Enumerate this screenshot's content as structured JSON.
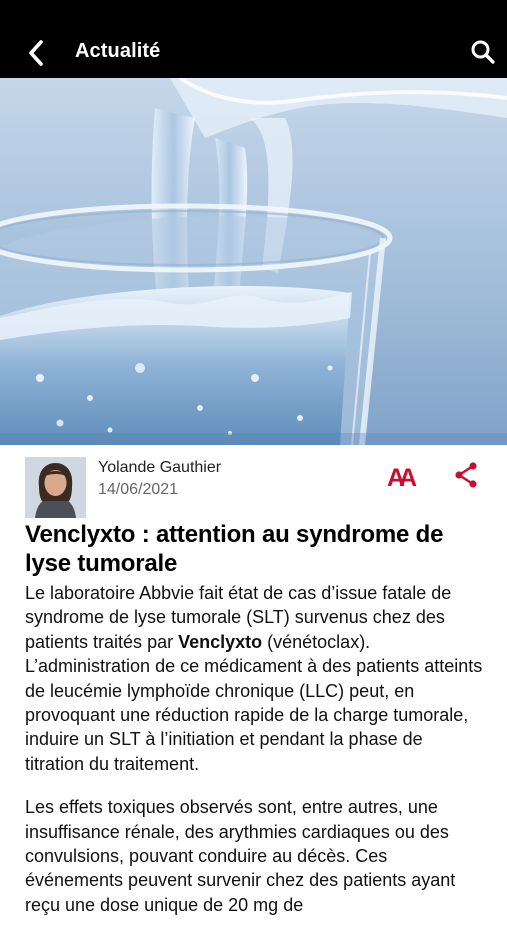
{
  "header": {
    "title": "Actualité",
    "back_icon": "chevron-left-icon",
    "search_icon": "search-icon"
  },
  "hero": {
    "image": "water-pouring-into-glass"
  },
  "meta": {
    "author": "Yolande Gauthier",
    "date": "14/06/2021",
    "font_size_label": "AA",
    "share_icon": "share-icon"
  },
  "article": {
    "title": "Venclyxto : attention au syndrome de lyse tumorale",
    "p1_before": "Le laboratoire Abbvie fait état de cas d’issue fatale de syndrome de lyse tumorale (SLT) survenus chez des patients traités par ",
    "p1_bold": "Venclyxto",
    "p1_after": " (vénétoclax). L’administration de ce médicament à des patients atteints de leucémie lymphoïde chronique (LLC) peut, en provoquant une réduction rapide de la charge tumorale, induire un SLT à l’initiation et pendant la phase de titration du traitement.",
    "p2": "Les effets toxiques observés sont, entre autres, une insuffisance rénale, des arythmies cardiaques ou des convulsions, pouvant conduire au décès. Ces événements peuvent survenir chez des patients ayant reçu une dose unique de 20 mg de"
  },
  "colors": {
    "header_bg": "#000000",
    "accent": "#c8102e"
  }
}
